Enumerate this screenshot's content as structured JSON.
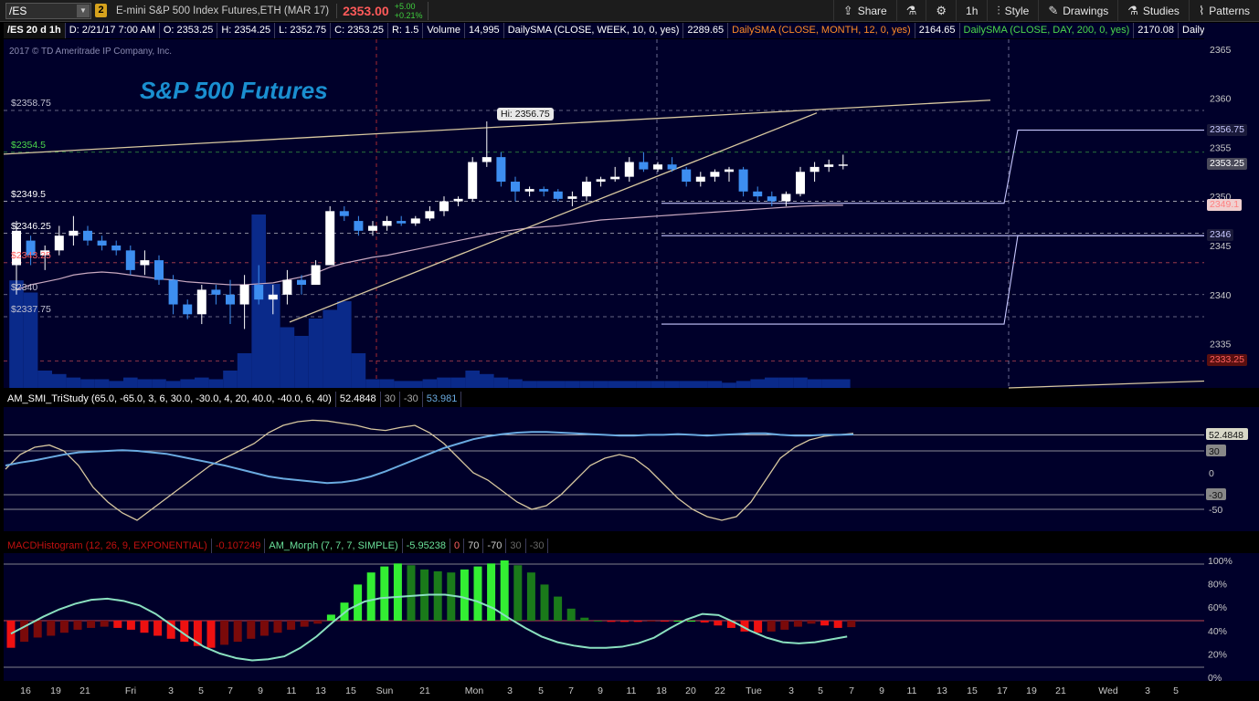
{
  "toolbar": {
    "symbol": "/ES",
    "link_badge": "2",
    "description": "E-mini S&P 500 Index Futures,ETH (MAR 17)",
    "last_price": "2353.00",
    "change": "+5.00",
    "change_pct": "+0.21%",
    "buttons": [
      {
        "label": "Share",
        "icon": "share-icon"
      },
      {
        "label": "",
        "icon": "flask-icon"
      },
      {
        "label": "",
        "icon": "gear-icon"
      },
      {
        "label": "1h",
        "icon": ""
      },
      {
        "label": "Style",
        "icon": "candle-style-icon"
      },
      {
        "label": "Drawings",
        "icon": "pencil-icon"
      },
      {
        "label": "Studies",
        "icon": "flask-icon"
      },
      {
        "label": "Patterns",
        "icon": "patterns-icon"
      }
    ]
  },
  "legend": {
    "symbol_period": "/ES 20 d 1h",
    "date": "D: 2/21/17 7:00 AM",
    "open": "O: 2353.25",
    "high": "H: 2354.25",
    "low": "L: 2352.75",
    "close": "C: 2353.25",
    "range": "R: 1.5",
    "volume_label": "Volume",
    "volume_value": "14,995",
    "sma_week": "DailySMA (CLOSE, WEEK, 10, 0, yes)",
    "sma_week_value": "2289.65",
    "sma_month": "DailySMA (CLOSE, MONTH, 12, 0, yes)",
    "sma_month_value": "2164.65",
    "sma_day": "DailySMA (CLOSE, DAY, 200, 0, yes)",
    "sma_day_value": "2170.08",
    "more": "Daily..."
  },
  "main_chart": {
    "title": "S&P 500 Futures",
    "copyright": "2017 © TD Ameritrade IP Company, Inc.",
    "hi_label": "Hi: 2356.75",
    "level_labels": [
      "$2358.75",
      "$2354.5",
      "$2349.5",
      "$2346.25",
      "$2343.25",
      "$2340",
      "$2337.75"
    ],
    "right_tags": [
      {
        "text": "2356.75",
        "price": 2356.75,
        "color": "#c8c8ff",
        "bg": "#1a1a3a"
      },
      {
        "text": "2353.25",
        "price": 2353.25,
        "color": "#ffffff",
        "bg": "#4a4a5a"
      },
      {
        "text": "2349.1",
        "price": 2349.1,
        "color": "#ff8080",
        "bg": "#f0d0d0"
      },
      {
        "text": "2346",
        "price": 2346,
        "color": "#c8c8ff",
        "bg": "#1a1a3a"
      },
      {
        "text": "2333.25",
        "price": 2333.25,
        "color": "#ff6060",
        "bg": "#5a1010"
      }
    ],
    "y_axis_ticks": [
      "2365",
      "2360",
      "2355",
      "2350",
      "2345",
      "2340",
      "2335"
    ]
  },
  "chart_data": [
    {
      "type": "candlestick",
      "title": "S&P 500 Futures",
      "ylim": [
        2330.5,
        2366
      ],
      "session_marker": "2/17/17",
      "candles": [
        {
          "o": 2343.0,
          "h": 2347.5,
          "l": 2340.0,
          "c": 2346.5
        },
        {
          "o": 2345.5,
          "h": 2346.0,
          "l": 2343.0,
          "c": 2344.0
        },
        {
          "o": 2344.0,
          "h": 2345.0,
          "l": 2342.5,
          "c": 2344.5
        },
        {
          "o": 2344.5,
          "h": 2347.0,
          "l": 2344.0,
          "c": 2346.0
        },
        {
          "o": 2346.0,
          "h": 2348.0,
          "l": 2345.0,
          "c": 2346.5
        },
        {
          "o": 2346.5,
          "h": 2347.0,
          "l": 2345.0,
          "c": 2345.5
        },
        {
          "o": 2345.5,
          "h": 2346.0,
          "l": 2344.5,
          "c": 2345.0
        },
        {
          "o": 2345.0,
          "h": 2345.5,
          "l": 2344.0,
          "c": 2344.5
        },
        {
          "o": 2344.5,
          "h": 2345.0,
          "l": 2342.0,
          "c": 2342.5
        },
        {
          "o": 2343.0,
          "h": 2344.5,
          "l": 2342.0,
          "c": 2343.5
        },
        {
          "o": 2343.5,
          "h": 2344.0,
          "l": 2341.0,
          "c": 2341.5
        },
        {
          "o": 2341.5,
          "h": 2342.0,
          "l": 2338.0,
          "c": 2339.0
        },
        {
          "o": 2339.0,
          "h": 2339.5,
          "l": 2337.5,
          "c": 2338.0
        },
        {
          "o": 2338.0,
          "h": 2341.0,
          "l": 2337.0,
          "c": 2340.5
        },
        {
          "o": 2340.5,
          "h": 2341.0,
          "l": 2339.0,
          "c": 2340.0
        },
        {
          "o": 2340.0,
          "h": 2341.5,
          "l": 2337.0,
          "c": 2339.0
        },
        {
          "o": 2339.0,
          "h": 2342.0,
          "l": 2336.5,
          "c": 2341.0
        },
        {
          "o": 2341.0,
          "h": 2343.0,
          "l": 2339.0,
          "c": 2339.5
        },
        {
          "o": 2339.5,
          "h": 2341.0,
          "l": 2338.0,
          "c": 2340.0
        },
        {
          "o": 2340.0,
          "h": 2342.5,
          "l": 2339.0,
          "c": 2341.5
        },
        {
          "o": 2341.5,
          "h": 2342.0,
          "l": 2340.0,
          "c": 2341.0
        },
        {
          "o": 2341.0,
          "h": 2343.5,
          "l": 2341.0,
          "c": 2343.0
        },
        {
          "o": 2343.0,
          "h": 2349.0,
          "l": 2343.0,
          "c": 2348.5
        },
        {
          "o": 2348.5,
          "h": 2349.0,
          "l": 2347.5,
          "c": 2348.0
        },
        {
          "o": 2347.5,
          "h": 2348.0,
          "l": 2346.0,
          "c": 2346.5
        },
        {
          "o": 2346.5,
          "h": 2347.5,
          "l": 2346.0,
          "c": 2347.0
        },
        {
          "o": 2347.0,
          "h": 2348.0,
          "l": 2346.5,
          "c": 2347.5
        },
        {
          "o": 2347.5,
          "h": 2348.0,
          "l": 2347.0,
          "c": 2347.25
        },
        {
          "o": 2347.25,
          "h": 2348.0,
          "l": 2347.0,
          "c": 2347.75
        },
        {
          "o": 2347.75,
          "h": 2349.0,
          "l": 2347.5,
          "c": 2348.5
        },
        {
          "o": 2348.5,
          "h": 2350.0,
          "l": 2348.0,
          "c": 2349.5
        },
        {
          "o": 2349.5,
          "h": 2350.0,
          "l": 2349.0,
          "c": 2349.75
        },
        {
          "o": 2349.75,
          "h": 2354.0,
          "l": 2349.5,
          "c": 2353.5
        },
        {
          "o": 2353.5,
          "h": 2356.75,
          "l": 2353.0,
          "c": 2354.0
        },
        {
          "o": 2354.0,
          "h": 2354.5,
          "l": 2351.0,
          "c": 2351.5
        },
        {
          "o": 2351.5,
          "h": 2352.0,
          "l": 2349.5,
          "c": 2350.5
        },
        {
          "o": 2350.5,
          "h": 2351.0,
          "l": 2350.0,
          "c": 2350.75
        },
        {
          "o": 2350.75,
          "h": 2351.0,
          "l": 2350.0,
          "c": 2350.5
        },
        {
          "o": 2350.5,
          "h": 2350.75,
          "l": 2349.5,
          "c": 2349.75
        },
        {
          "o": 2349.75,
          "h": 2350.5,
          "l": 2349.0,
          "c": 2350.0
        },
        {
          "o": 2350.0,
          "h": 2352.0,
          "l": 2349.5,
          "c": 2351.5
        },
        {
          "o": 2351.5,
          "h": 2352.0,
          "l": 2351.0,
          "c": 2351.75
        },
        {
          "o": 2351.75,
          "h": 2353.0,
          "l": 2351.5,
          "c": 2352.0
        },
        {
          "o": 2352.0,
          "h": 2354.0,
          "l": 2351.5,
          "c": 2353.5
        },
        {
          "o": 2353.5,
          "h": 2354.5,
          "l": 2352.5,
          "c": 2352.75
        },
        {
          "o": 2352.75,
          "h": 2353.5,
          "l": 2352.5,
          "c": 2353.25
        },
        {
          "o": 2353.25,
          "h": 2354.0,
          "l": 2352.5,
          "c": 2352.75
        },
        {
          "o": 2352.75,
          "h": 2353.0,
          "l": 2351.0,
          "c": 2351.5
        },
        {
          "o": 2351.5,
          "h": 2352.5,
          "l": 2351.0,
          "c": 2352.0
        },
        {
          "o": 2352.0,
          "h": 2352.75,
          "l": 2351.5,
          "c": 2352.5
        },
        {
          "o": 2352.5,
          "h": 2353.0,
          "l": 2351.5,
          "c": 2352.75
        },
        {
          "o": 2352.75,
          "h": 2353.0,
          "l": 2350.0,
          "c": 2350.5
        },
        {
          "o": 2350.5,
          "h": 2351.0,
          "l": 2349.5,
          "c": 2350.0
        },
        {
          "o": 2350.0,
          "h": 2350.5,
          "l": 2349.0,
          "c": 2349.5
        },
        {
          "o": 2349.5,
          "h": 2350.5,
          "l": 2349.0,
          "c": 2350.25
        },
        {
          "o": 2350.25,
          "h": 2353.0,
          "l": 2350.0,
          "c": 2352.5
        },
        {
          "o": 2352.5,
          "h": 2353.5,
          "l": 2351.5,
          "c": 2353.0
        },
        {
          "o": 2353.0,
          "h": 2353.75,
          "l": 2352.5,
          "c": 2353.25
        },
        {
          "o": 2353.25,
          "h": 2354.25,
          "l": 2352.75,
          "c": 2353.25
        }
      ],
      "volume_rel": [
        0.62,
        0.55,
        0.1,
        0.08,
        0.06,
        0.05,
        0.05,
        0.04,
        0.06,
        0.05,
        0.05,
        0.04,
        0.05,
        0.06,
        0.05,
        0.1,
        0.2,
        1.0,
        0.6,
        0.35,
        0.3,
        0.4,
        0.45,
        0.5,
        0.2,
        0.05,
        0.05,
        0.04,
        0.04,
        0.05,
        0.06,
        0.06,
        0.1,
        0.08,
        0.06,
        0.05,
        0.04,
        0.04,
        0.04,
        0.04,
        0.04,
        0.04,
        0.04,
        0.04,
        0.04,
        0.04,
        0.04,
        0.04,
        0.04,
        0.04,
        0.03,
        0.04,
        0.05,
        0.06,
        0.06,
        0.06,
        0.05,
        0.05,
        0.05
      ],
      "x_labels": [
        "16",
        "19",
        "21",
        "Fri",
        "3",
        "5",
        "7",
        "9",
        "11",
        "13",
        "15",
        "Sun",
        "21",
        "Mon",
        "3",
        "5",
        "7",
        "9",
        "11",
        "18",
        "20",
        "22",
        "Tue",
        "3",
        "5",
        "7",
        "9",
        "11",
        "13",
        "15",
        "17",
        "19",
        "21",
        "Wed",
        "3",
        "5"
      ]
    },
    {
      "type": "line",
      "title": "AM_SMI_TriStudy (65.0, -65.0, 3, 6, 30.0, -30.0, 4, 20, 40.0, -40.0, 6, 40)",
      "ylim": [
        -80,
        90
      ],
      "series": [
        {
          "name": "SMI",
          "values": [
            10,
            14,
            17,
            21,
            25,
            28,
            29,
            30,
            31,
            30,
            28,
            26,
            22,
            18,
            14,
            10,
            5,
            0,
            -5,
            -8,
            -10,
            -12,
            -14,
            -13,
            -10,
            -5,
            2,
            10,
            18,
            26,
            34,
            40,
            46,
            50,
            53,
            55,
            56,
            56,
            55,
            54,
            53,
            52,
            51,
            51,
            52,
            52,
            53,
            52,
            51,
            52,
            53,
            54,
            54,
            52,
            51,
            51,
            52,
            52,
            52.4848
          ]
        },
        {
          "name": "Smooth",
          "values": [
            5,
            25,
            35,
            38,
            30,
            10,
            -20,
            -40,
            -55,
            -65,
            -50,
            -35,
            -20,
            -5,
            10,
            20,
            30,
            40,
            55,
            65,
            70,
            72,
            71,
            68,
            65,
            60,
            58,
            62,
            65,
            55,
            40,
            20,
            0,
            -10,
            -25,
            -40,
            -50,
            -45,
            -30,
            -10,
            10,
            20,
            25,
            20,
            5,
            -15,
            -35,
            -50,
            -60,
            -65,
            -60,
            -40,
            -10,
            20,
            35,
            45,
            50,
            52,
            53.981
          ]
        }
      ],
      "values_shown": {
        "smi": "52.4848",
        "upper": "30",
        "lower": "-30",
        "smooth": "53.981"
      }
    },
    {
      "type": "bar",
      "title": "MACDHistogram (12, 26, 9, EXPONENTIAL)",
      "ylim": [
        -0.5,
        0.5
      ],
      "values": [
        -0.45,
        -0.35,
        -0.28,
        -0.25,
        -0.2,
        -0.15,
        -0.12,
        -0.1,
        -0.12,
        -0.15,
        -0.2,
        -0.25,
        -0.3,
        -0.35,
        -0.42,
        -0.45,
        -0.4,
        -0.35,
        -0.3,
        -0.25,
        -0.2,
        -0.15,
        -0.1,
        -0.05,
        0.1,
        0.3,
        0.6,
        0.8,
        0.9,
        0.95,
        0.92,
        0.85,
        0.82,
        0.8,
        0.85,
        0.9,
        0.95,
        1.0,
        0.92,
        0.8,
        0.6,
        0.4,
        0.2,
        0.05,
        0.0,
        -0.02,
        -0.02,
        -0.02,
        -0.01,
        -0.01,
        0.0,
        0.0,
        -0.03,
        -0.08,
        -0.12,
        -0.18,
        -0.2,
        -0.18,
        -0.15,
        -0.1,
        -0.05,
        -0.08,
        -0.12,
        -0.107249
      ],
      "value_shown": "-0.107249"
    },
    {
      "type": "line",
      "title": "AM_Morph (7, 7, 7, SIMPLE)",
      "value_shown": "-5.95238",
      "levels": [
        "0",
        "70",
        "-70",
        "30",
        "-30"
      ],
      "y_axis_ticks": [
        "100%",
        "80%",
        "60%",
        "40%",
        "20%",
        "0%"
      ]
    }
  ],
  "sub_legend_smi": {
    "name": "AM_SMI_TriStudy (65.0, -65.0, 3, 6, 30.0, -30.0, 4, 20, 40.0, -40.0, 6, 40)",
    "value": "52.4848",
    "upper": "30",
    "lower": "-30",
    "smooth": "53.981",
    "ticks": [
      "52.4848",
      "30",
      "0",
      "-30",
      "-50"
    ]
  },
  "sub_legend_macd": {
    "name": "MACDHistogram (12, 26, 9, EXPONENTIAL)",
    "value": "-0.107249",
    "morph": "AM_Morph (7, 7, 7, SIMPLE)",
    "morph_value": "-5.95238",
    "levels": [
      "0",
      "70",
      "-70",
      "30",
      "-30"
    ],
    "ticks": [
      "100%",
      "80%",
      "60%",
      "40%",
      "20%",
      "0%"
    ]
  },
  "colors": {
    "panel_bg": "#00002a",
    "up_candle": "#ffffff",
    "down_candle": "#3d8ef0",
    "volume": "#0a2a8a",
    "macd_up": "#33ee33",
    "macd_up_dark": "#1a7a1a",
    "macd_down": "#ee1111",
    "macd_down_dark": "#7a0a0a",
    "smi": "#6aaae0",
    "smooth": "#d8c8a0",
    "trend": "#d8c8a0"
  }
}
